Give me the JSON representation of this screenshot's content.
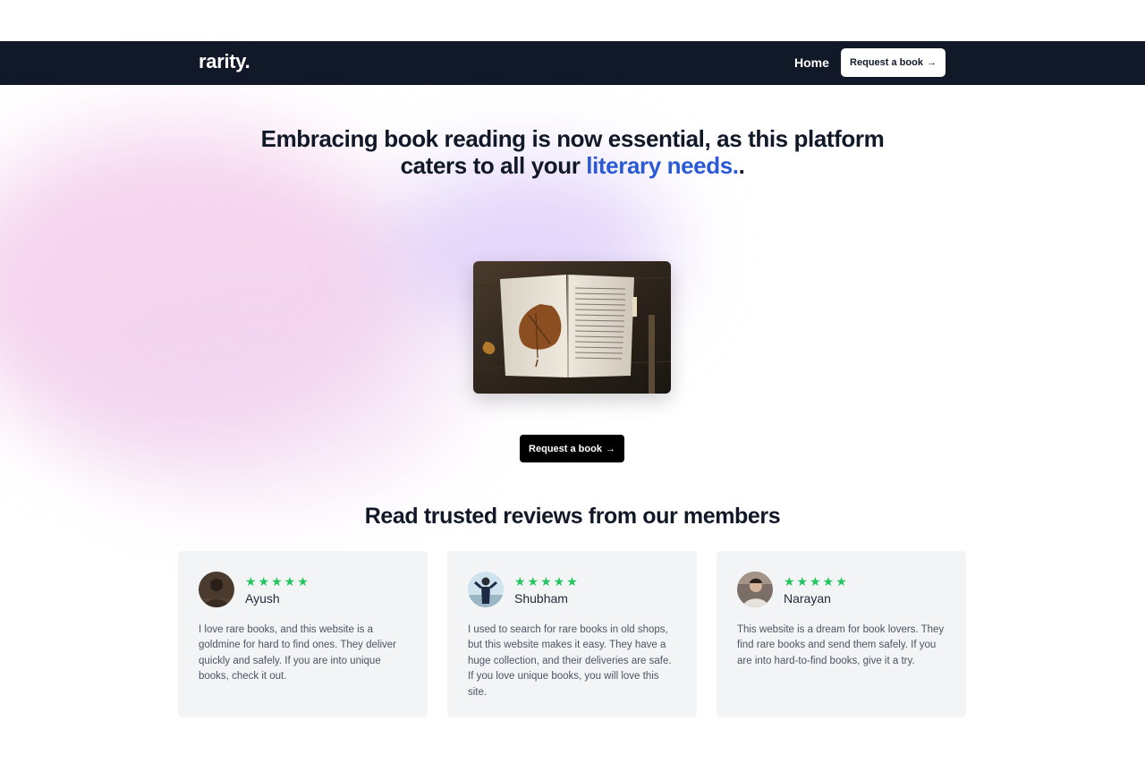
{
  "navbar": {
    "brand": "rarity.",
    "home_label": "Home",
    "cta_label": "Request a book",
    "cta_arrow": "→"
  },
  "hero": {
    "title_main": "Embracing book reading is now essential, as this platform caters to all your ",
    "title_accent": "literary needs.",
    "title_end": ".",
    "cta_label": "Request a book",
    "cta_arrow": "→",
    "image_icon": "open-book-with-leaf-photo"
  },
  "reviews": {
    "heading": "Read trusted reviews from our members",
    "items": [
      {
        "name": "Ayush",
        "rating": 5,
        "stars": "★★★★★",
        "text": "I love rare books, and this website is a goldmine for hard to find ones. They deliver quickly and safely. If you are into unique books, check it out."
      },
      {
        "name": "Shubham",
        "rating": 5,
        "stars": "★★★★★",
        "text": "I used to search for rare books in old shops, but this website makes it easy. They have a huge collection, and their deliveries are safe. If you love unique books, you will love this site."
      },
      {
        "name": "Narayan",
        "rating": 5,
        "stars": "★★★★★",
        "text": "This website is a dream for book lovers. They find rare books and send them safely. If you are into hard-to-find books, give it a try."
      }
    ]
  },
  "colors": {
    "nav_bg": "#111827",
    "accent_blue": "#2a5ad6",
    "star_green": "#22c55e",
    "card_bg": "#f3f4f6"
  }
}
